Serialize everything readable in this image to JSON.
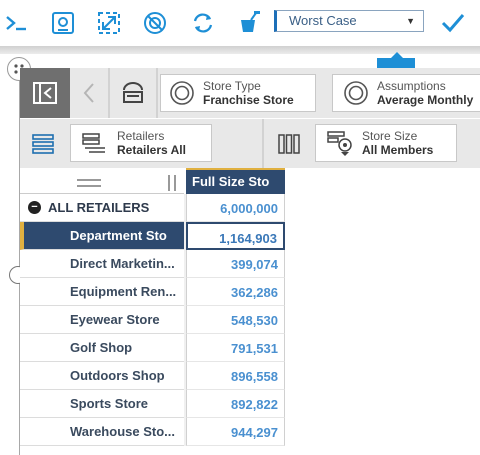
{
  "toolbar": {
    "icons": [
      "terminal-icon",
      "save-icon",
      "expand-icon",
      "cancel-icon",
      "refresh-icon",
      "paint-bucket-icon",
      "checkmark-icon"
    ],
    "scenario": "Worst Case"
  },
  "filters": {
    "store_type": {
      "label": "Store Type",
      "value": "Franchise Store"
    },
    "assumptions": {
      "label": "Assumptions",
      "value": "Average Monthly"
    },
    "retailers": {
      "label": "Retailers",
      "value": "Retailers All"
    },
    "store_size": {
      "label": "Store Size",
      "value": "All Members"
    }
  },
  "grid": {
    "column_header": "Full Size Sto",
    "rows": [
      {
        "label": "ALL RETAILERS",
        "value": "6,000,000"
      },
      {
        "label": "Department Sto",
        "value": "1,164,903"
      },
      {
        "label": "Direct Marketin...",
        "value": "399,074"
      },
      {
        "label": "Equipment Ren...",
        "value": "362,286"
      },
      {
        "label": "Eyewear Store",
        "value": "548,530"
      },
      {
        "label": "Golf Shop",
        "value": "791,531"
      },
      {
        "label": "Outdoors Shop",
        "value": "896,558"
      },
      {
        "label": "Sports Store",
        "value": "892,822"
      },
      {
        "label": "Warehouse Sto...",
        "value": "944,297"
      }
    ]
  }
}
